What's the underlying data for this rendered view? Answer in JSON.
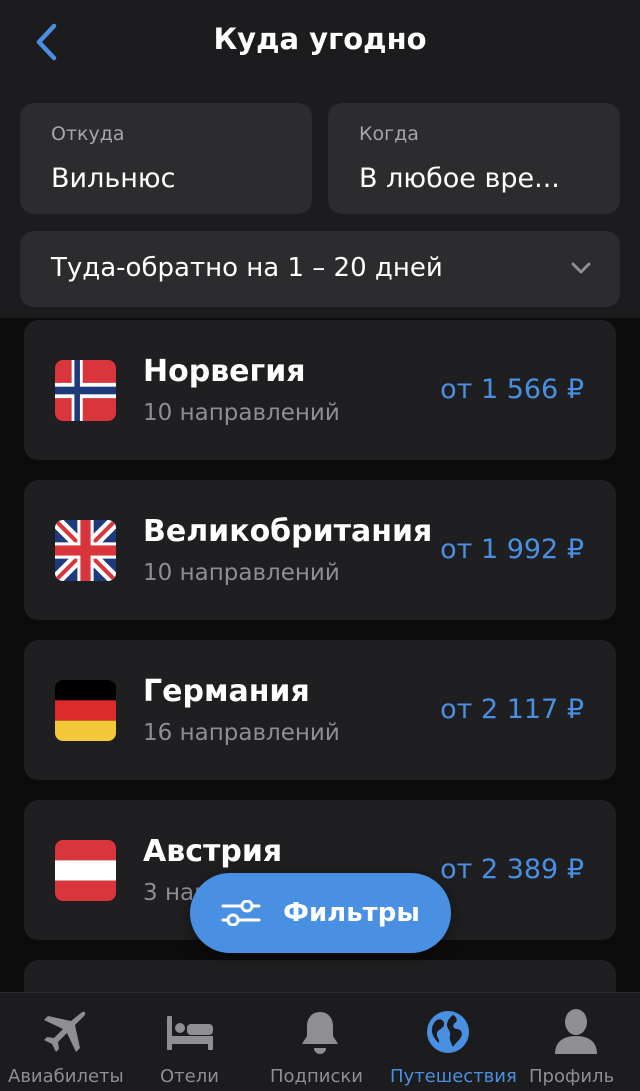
{
  "header": {
    "title": "Куда угодно",
    "back_icon": "chevron-left-icon"
  },
  "search": {
    "from_label": "Откуда",
    "from_value": "Вильнюс",
    "when_label": "Когда",
    "when_value": "В любое вре...",
    "trip_type": "Туда-обратно на 1 – 20 дней"
  },
  "destinations": [
    {
      "country": "Норвегия",
      "count": "10 направлений",
      "price": "от 1 566 ₽",
      "flag": "norway-flag"
    },
    {
      "country": "Великобритания",
      "count": "10 направлений",
      "price": "от 1 992 ₽",
      "flag": "uk-flag"
    },
    {
      "country": "Германия",
      "count": "16 направлений",
      "price": "от 2 117 ₽",
      "flag": "germany-flag"
    },
    {
      "country": "Австрия",
      "count": "3 направления",
      "price": "от 2 389 ₽",
      "flag": "austria-flag"
    }
  ],
  "filters": {
    "label": "Фильтры"
  },
  "tabbar": {
    "tabs": [
      {
        "label": "Авиабилеты",
        "icon": "airplane-icon"
      },
      {
        "label": "Отели",
        "icon": "bed-icon"
      },
      {
        "label": "Подписки",
        "icon": "bell-icon"
      },
      {
        "label": "Путешествия",
        "icon": "globe-icon",
        "active": true
      },
      {
        "label": "Профиль",
        "icon": "person-icon"
      }
    ]
  },
  "colors": {
    "accent": "#4a90e2",
    "background": "#0c0c0d",
    "card": "#1f1f21",
    "field": "#2c2c2e"
  }
}
